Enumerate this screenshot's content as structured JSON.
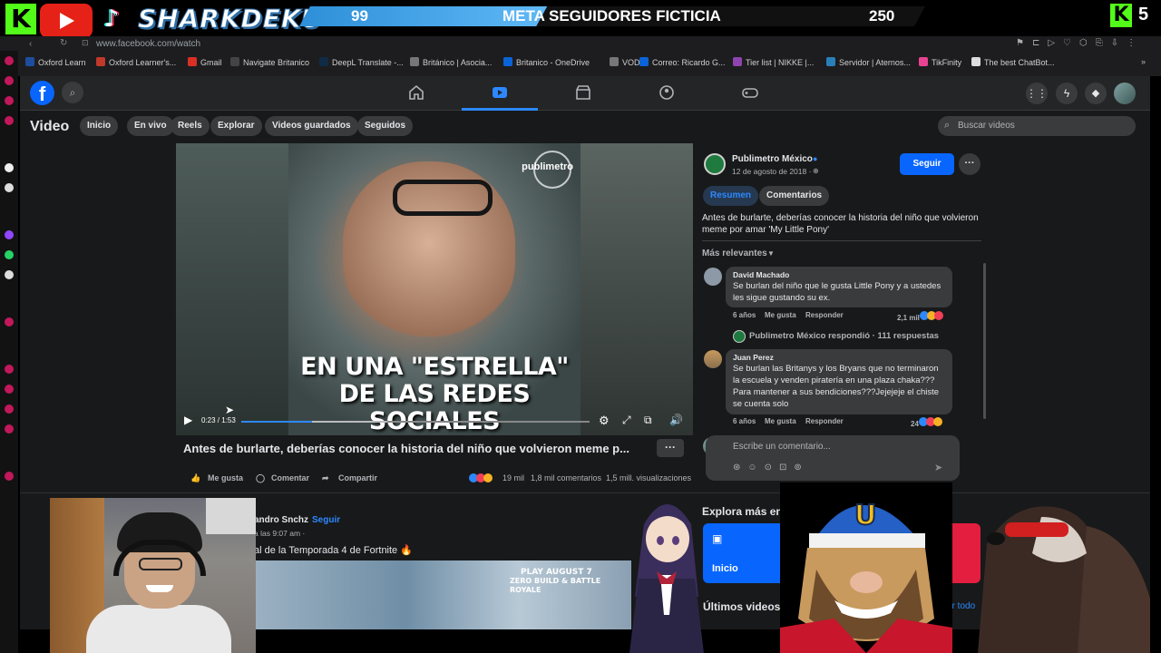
{
  "overlay": {
    "brand": "SHARKDEKU",
    "goal_current": "99",
    "goal_title": "META SEGUIDORES FICTICIA",
    "goal_target": "250",
    "kick_count": "5",
    "goal_progress": 0.396,
    "colors": {
      "kick": "#53fc18",
      "youtube": "#e62117",
      "goal_fill": "#3fa3ea"
    }
  },
  "browser": {
    "url": "www.facebook.com/watch",
    "bookmarks": [
      {
        "label": "Oxford Learn",
        "color": "#1d4e9e"
      },
      {
        "label": "Oxford Learner's...",
        "color": "#c0392b"
      },
      {
        "label": "Gmail",
        "color": "#d93025"
      },
      {
        "label": "Navigate Britanico",
        "color": "#444444"
      },
      {
        "label": "DeepL Translate -...",
        "color": "#0f2b46"
      },
      {
        "label": "Británico | Asocia...",
        "color": "#777777"
      },
      {
        "label": "Britanico - OneDrive",
        "color": "#0a64d8"
      },
      {
        "label": "VODs",
        "color": "#777777"
      },
      {
        "label": "Correo: Ricardo G...",
        "color": "#0a64d8"
      },
      {
        "label": "Tier list | NIKKE |...",
        "color": "#8e44ad"
      },
      {
        "label": "Servidor | Aternos...",
        "color": "#2980b9"
      },
      {
        "label": "TikFinity",
        "color": "#e84393"
      },
      {
        "label": "The best ChatBot...",
        "color": "#dddddd"
      }
    ]
  },
  "fb_nav": {
    "logo": "f",
    "icons": [
      "home-icon",
      "video-icon",
      "marketplace-icon",
      "groups-icon",
      "gaming-icon"
    ],
    "right_icons": [
      "menu-grid-icon",
      "messenger-icon",
      "notifications-icon",
      "profile-avatar"
    ]
  },
  "video_header": {
    "title": "Video",
    "tabs": [
      "Inicio",
      "En vivo",
      "Reels",
      "Explorar",
      "Videos guardados",
      "Seguidos"
    ],
    "search_placeholder": "Buscar videos"
  },
  "video": {
    "watermark": "publimetro",
    "caption_line1": "EN UNA \"ESTRELLA\"",
    "caption_line2": "DE LAS REDES SOCIALES",
    "time": "0:23 / 1:53",
    "progress": 0.204,
    "buffered": 0.42,
    "title": "Antes de burlarte, deberías conocer la historia del niño que volvieron meme p...",
    "more": "···",
    "actions": {
      "like": "Me gusta",
      "comment": "Comentar",
      "share": "Compartir"
    },
    "stats": {
      "reactions": "19 mil",
      "comments": "1,8 mil comentarios",
      "views": "1,5 mill. visualizaciones"
    }
  },
  "panel": {
    "page_name": "Publimetro México",
    "date": "12 de agosto de 2018 · ",
    "follow": "Seguir",
    "more": "···",
    "tabs": [
      "Resumen",
      "Comentarios"
    ],
    "description": "Antes de burlarte, deberías conocer la historia del niño que volvieron meme por amar 'My Little Pony'",
    "sort": "Más relevantes",
    "comments": [
      {
        "author": "David Machado",
        "text": "Se burlan del niño que le gusta Little Pony y a ustedes les sigue gustando su ex.",
        "age": "6 años",
        "like": "Me gusta",
        "reply": "Responder",
        "count": "2,1 mil"
      },
      {
        "author": "Juan Perez",
        "text": "Se burlan las Britanys y los Bryans que no terminaron la escuela y venden piratería en una plaza chaka??? Para mantener a sus bendiciones???Jejejeje el chiste se cuenta solo",
        "age": "6 años",
        "like": "Me gusta",
        "reply": "Responder",
        "count": "24"
      }
    ],
    "reply_summary": "Publimetro México respondió · 111 respuestas",
    "compose_placeholder": "Escribe un comentario..."
  },
  "feed": {
    "author": "andro Snchz",
    "follow": "Seguir",
    "time": "a las 9:07 am · ",
    "text": "al de la Temporada 4 de Fortnite 🔥",
    "image_text1": "PLAY AUGUST 7",
    "image_text2": "ZERO BUILD & BATTLE ROYALE",
    "explore_title": "Explora más en V",
    "explore_inicio": "Inicio",
    "latest": "Últimos videos",
    "see_all": "er todo"
  },
  "stickers": {
    "dwarf_letter": "U"
  }
}
